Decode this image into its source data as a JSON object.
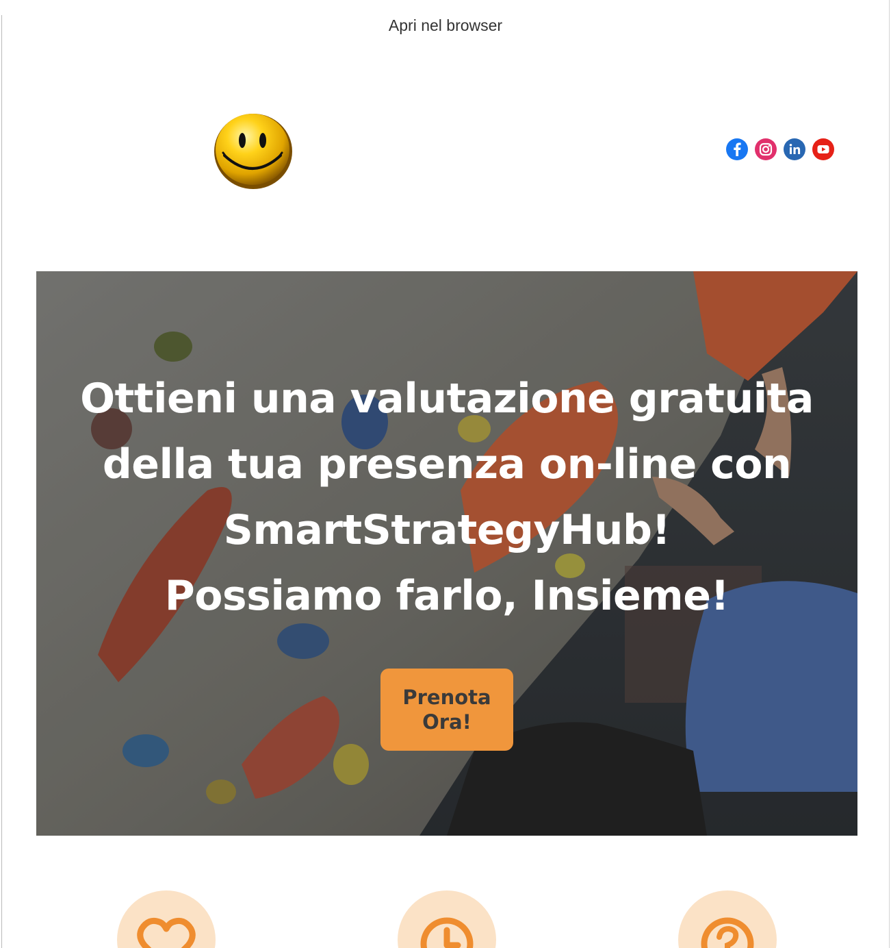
{
  "header": {
    "browser_link": "Apri nel browser"
  },
  "logo": {
    "icon": "smiley-logo-icon"
  },
  "social": [
    {
      "name": "facebook",
      "icon": "facebook-icon",
      "color": "#1877f2"
    },
    {
      "name": "instagram",
      "icon": "instagram-icon",
      "color": "#e1306c"
    },
    {
      "name": "linkedin",
      "icon": "linkedin-icon",
      "color": "#2867b2"
    },
    {
      "name": "youtube",
      "icon": "youtube-icon",
      "color": "#e62117"
    }
  ],
  "hero": {
    "title_lines": [
      "Ottieni una valutazione gratuita",
      "della tua presenza on-line con",
      "SmartStrategyHub!",
      "Possiamo farlo, Insieme!"
    ],
    "cta_label": "Prenota Ora!",
    "cta_color": "#f0963c"
  },
  "features": [
    {
      "icon": "heart-icon"
    },
    {
      "icon": "clock-icon"
    },
    {
      "icon": "question-icon"
    }
  ],
  "colors": {
    "accent": "#f0963c",
    "feature_bg": "#fbe2c6"
  }
}
